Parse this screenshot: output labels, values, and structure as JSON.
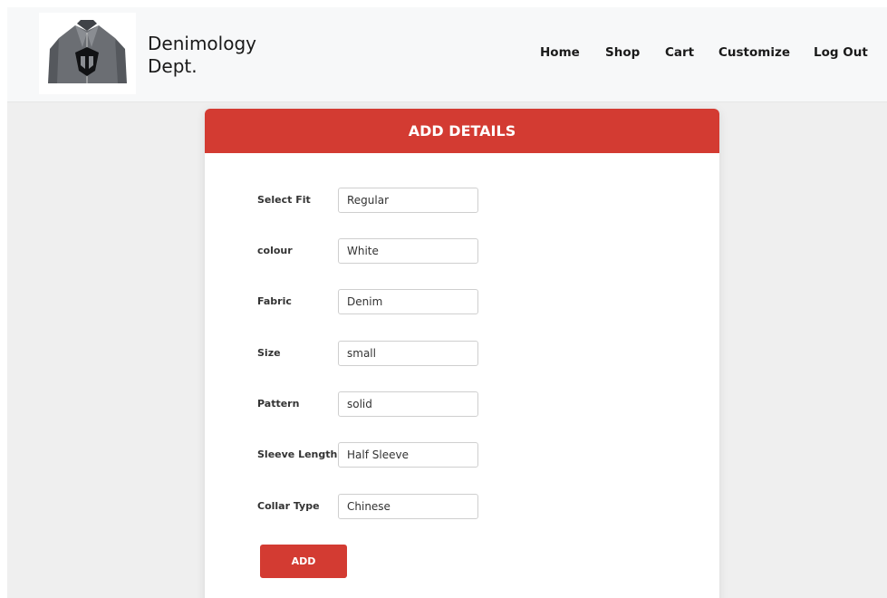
{
  "brand": {
    "name_line1": "Denimology",
    "name_line2": "Dept."
  },
  "nav": {
    "items": [
      {
        "label": "Home"
      },
      {
        "label": "Shop"
      },
      {
        "label": "Cart"
      },
      {
        "label": "Customize"
      },
      {
        "label": "Log Out"
      }
    ]
  },
  "form": {
    "title": "ADD DETAILS",
    "fields": [
      {
        "label": "Select Fit",
        "value": "Regular"
      },
      {
        "label": "colour",
        "value": "White"
      },
      {
        "label": "Fabric",
        "value": "Denim"
      },
      {
        "label": "Size",
        "value": "small"
      },
      {
        "label": "Pattern",
        "value": "solid"
      },
      {
        "label": "Sleeve Length",
        "value": "Half Sleeve"
      },
      {
        "label": "Collar Type",
        "value": "Chinese"
      }
    ],
    "submit_label": "ADD"
  },
  "colors": {
    "accent": "#d33b32",
    "navbar_bg": "#f7f8f9",
    "page_bg": "#efefef"
  },
  "icons": {
    "logo": "leather-jacket-logo"
  }
}
